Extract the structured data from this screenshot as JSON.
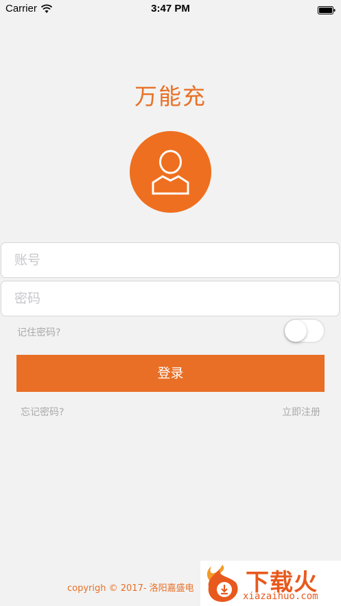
{
  "status_bar": {
    "carrier": "Carrier",
    "time": "3:47 PM",
    "wifi_icon": "wifi-icon",
    "battery_icon": "battery-icon"
  },
  "app": {
    "title": "万能充",
    "avatar_icon": "user-icon",
    "accent_color": "#e87025"
  },
  "form": {
    "account_placeholder": "账号",
    "password_placeholder": "密码",
    "account_value": "",
    "password_value": "",
    "remember_label": "记住密码?",
    "remember_on": false,
    "login_label": "登录",
    "forgot_label": "忘记密码?",
    "register_label": "立即注册"
  },
  "footer": {
    "copyright": "copyrigh © 2017- 洛阳嘉盛电"
  },
  "watermark": {
    "title": "下载火",
    "subtitle": "xiazaihuo.com",
    "icon": "flame-logo-icon"
  }
}
